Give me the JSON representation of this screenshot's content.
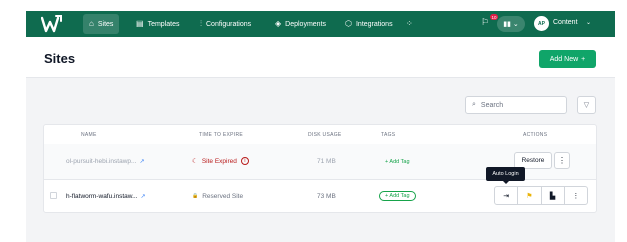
{
  "nav": {
    "items": [
      {
        "label": "Sites",
        "icon": "home-icon",
        "glyph": "⌂",
        "active": true
      },
      {
        "label": "Templates",
        "icon": "templates-icon",
        "glyph": "▤"
      },
      {
        "label": "Configurations",
        "icon": "sliders-icon",
        "glyph": "⫶"
      },
      {
        "label": "Deployments",
        "icon": "deploy-icon",
        "glyph": "◈"
      },
      {
        "label": "Integrations",
        "icon": "puzzle-icon",
        "glyph": "⬡"
      }
    ],
    "apps_glyph": "⁘",
    "bell_glyph": "⚐",
    "notification_count": "10",
    "stats_glyph": "▮▮",
    "avatar_initials": "AP",
    "user_label": "Content",
    "caret": "⌄"
  },
  "header": {
    "title": "Sites",
    "add_new_label": "Add New",
    "add_new_glyph": "+"
  },
  "toolbar": {
    "search_placeholder": "Search",
    "search_glyph": "⌕",
    "filter_glyph": "▽"
  },
  "table": {
    "columns": [
      "NAME",
      "TIME TO EXPIRE",
      "DISK USAGE",
      "TAGS",
      "ACTIONS"
    ],
    "rows": [
      {
        "name": "ol-pursuit-hebi.instawp...",
        "link_glyph": "↗",
        "expire_glyph": "☾",
        "expire": "Site Expired",
        "info_glyph": "i",
        "disk": "71 MB",
        "tag_action": "+ Add Tag",
        "restore_label": "Restore",
        "menu_glyph": "⋮"
      },
      {
        "name": "h-flatworm-wafu.instaw...",
        "link_glyph": "↗",
        "expire_glyph": "🔒",
        "expire": "Reserved Site",
        "disk": "73 MB",
        "tag_action": "+ Add Tag",
        "action_glyphs": {
          "login": "⇥",
          "flag": "⚑",
          "layout": "▙",
          "menu": "⋮"
        }
      }
    ],
    "tooltip": "Auto Login"
  },
  "colors": {
    "nav_bg": "#0f6b4f",
    "primary": "#10a569",
    "expired": "#b91c1c"
  }
}
